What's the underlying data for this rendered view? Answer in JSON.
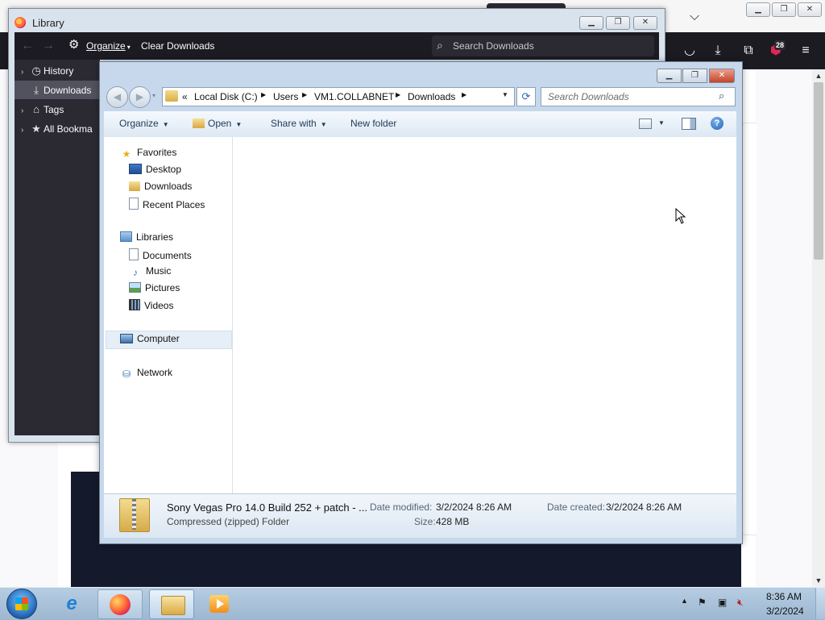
{
  "firefox": {
    "badge_count": "28"
  },
  "library": {
    "title": "Library",
    "toolbar": {
      "organize_label": "Organize",
      "clear_downloads_label": "Clear Downloads",
      "search_placeholder": "Search Downloads"
    },
    "sidebar": {
      "items": [
        {
          "label": "History",
          "icon": "clock-icon"
        },
        {
          "label": "Downloads",
          "icon": "download-icon",
          "selected": true
        },
        {
          "label": "Tags",
          "icon": "tag-icon"
        },
        {
          "label": "All Bookma",
          "icon": "star-icon"
        }
      ]
    }
  },
  "explorer": {
    "breadcrumb": [
      "Local Disk (C:)",
      "Users",
      "VM1.COLLABNET",
      "Downloads"
    ],
    "breadcrumb_overflow": "«",
    "search_placeholder": "Search Downloads",
    "commands": {
      "organize": "Organize",
      "open": "Open",
      "share_with": "Share with",
      "new_folder": "New folder"
    },
    "nav": {
      "favorites": {
        "label": "Favorites",
        "items": [
          "Desktop",
          "Downloads",
          "Recent Places"
        ]
      },
      "libraries": {
        "label": "Libraries",
        "items": [
          "Documents",
          "Music",
          "Pictures",
          "Videos"
        ]
      },
      "computer": "Computer",
      "network": "Network"
    },
    "details": {
      "file_name": "Sony Vegas Pro 14.0 Build 252 + patch - ...",
      "file_type": "Compressed (zipped) Folder",
      "date_modified_label": "Date modified:",
      "date_modified": "3/2/2024 8:26 AM",
      "date_created_label": "Date created:",
      "date_created": "3/2/2024 8:26 AM",
      "size_label": "Size:",
      "size": "428 MB"
    }
  },
  "taskbar": {
    "time": "8:36 AM",
    "date": "3/2/2024"
  }
}
